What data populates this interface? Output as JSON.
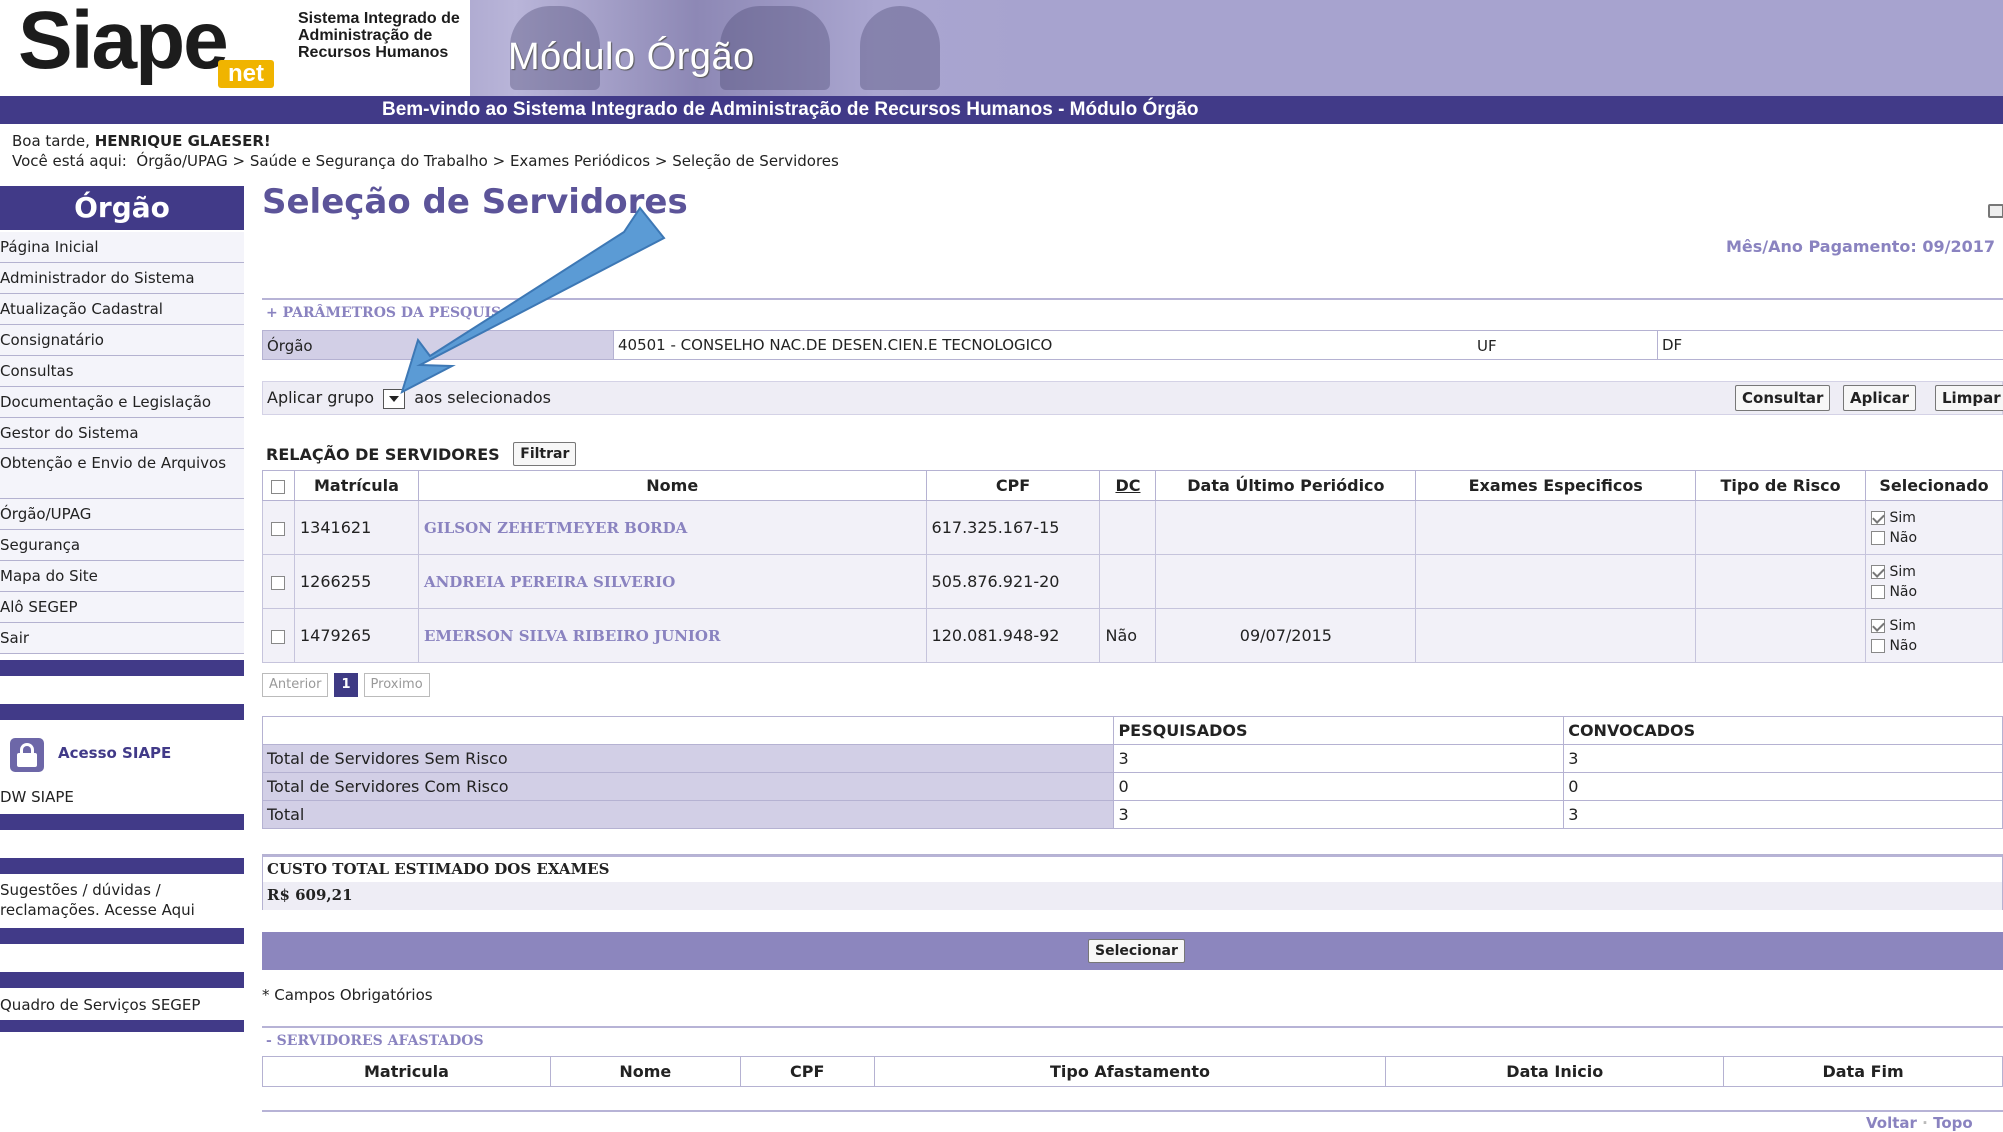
{
  "header": {
    "logo_main": "Siape",
    "logo_net": "net",
    "logo_sub_line1": "Sistema Integrado de",
    "logo_sub_line2": "Administração de",
    "logo_sub_line3": "Recursos Humanos",
    "module": "Módulo Órgão",
    "welcome": "Bem-vindo ao Sistema Integrado de Administração de Recursos Humanos - Módulo Órgão"
  },
  "greeting": {
    "prefix": "Boa tarde, ",
    "user": "HENRIQUE GLAESER!"
  },
  "breadcrumb": {
    "label": "Você está aqui:",
    "items": [
      "Órgão/UPAG",
      "Saúde e Segurança do Trabalho",
      "Exames Periódicos",
      "Seleção de Servidores"
    ],
    "separator": ">"
  },
  "sidebar": {
    "title": "Órgão",
    "items": [
      {
        "label": "Página Inicial"
      },
      {
        "label": "Administrador do Sistema"
      },
      {
        "label": "Atualização Cadastral"
      },
      {
        "label": "Consignatário"
      },
      {
        "label": "Consultas"
      },
      {
        "label": "Documentação e Legislação"
      },
      {
        "label": "Gestor do Sistema"
      },
      {
        "label": "Obtenção e Envio de Arquivos"
      },
      {
        "label": "Órgão/UPAG"
      },
      {
        "label": "Segurança"
      },
      {
        "label": "Mapa do Site"
      },
      {
        "label": "Alô SEGEP"
      },
      {
        "label": "Sair"
      }
    ],
    "acesso": "Acesso SIAPE",
    "dw": "DW SIAPE",
    "sugestoes_line1": "Sugestões / dúvidas /",
    "sugestoes_line2": "reclamações. Acesse Aqui",
    "quadro": "Quadro de Serviços SEGEP"
  },
  "main": {
    "title": "Seleção de Servidores",
    "mes_ano_label": "Mês/Ano Pagamento:",
    "mes_ano_value": "09/2017",
    "params": {
      "header": "+ PARÂMETROS DA PESQUISA",
      "orgao_label": "Órgão",
      "orgao_value": "40501 - CONSELHO NAC.DE DESEN.CIEN.E TECNOLOGICO",
      "uf_label": "UF",
      "uf_value": "DF"
    },
    "group": {
      "prefix": "Aplicar grupo",
      "suffix": "aos selecionados",
      "consultar": "Consultar",
      "aplicar": "Aplicar",
      "limpar": "Limpar"
    },
    "relacao_title": "RELAÇÃO DE SERVIDORES",
    "filtrar": "Filtrar",
    "columns": [
      "Matrícula",
      "Nome",
      "CPF",
      "DC",
      "Data Último Periódico",
      "Exames Especificos",
      "Tipo de Risco",
      "Selecionado"
    ],
    "sim_label": "Sim",
    "nao_label": "Não",
    "rows": [
      {
        "matricula": "1341621",
        "nome": "GILSON ZEHETMEYER BORDA",
        "cpf": "617.325.167-15",
        "dc": "",
        "data": "",
        "exames": "",
        "risco": ""
      },
      {
        "matricula": "1266255",
        "nome": "ANDREIA PEREIRA SILVERIO",
        "cpf": "505.876.921-20",
        "dc": "",
        "data": "",
        "exames": "",
        "risco": ""
      },
      {
        "matricula": "1479265",
        "nome": "EMERSON SILVA RIBEIRO JUNIOR",
        "cpf": "120.081.948-92",
        "dc": "Não",
        "data": "09/07/2015",
        "exames": "",
        "risco": ""
      }
    ],
    "pager": {
      "prev": "Anterior",
      "page": "1",
      "next": "Proximo"
    },
    "totals": {
      "col_pesq": "PESQUISADOS",
      "col_conv": "CONVOCADOS",
      "rows": [
        {
          "label": "Total de Servidores Sem Risco",
          "pesq": "3",
          "conv": "3"
        },
        {
          "label": "Total de Servidores Com Risco",
          "pesq": "0",
          "conv": "0"
        },
        {
          "label": "Total",
          "pesq": "3",
          "conv": "3"
        }
      ]
    },
    "custo_label": "CUSTO TOTAL ESTIMADO DOS EXAMES",
    "custo_value": "R$ 609,21",
    "selecionar": "Selecionar",
    "campos": "* Campos Obrigatórios",
    "afastados": {
      "header": "- SERVIDORES AFASTADOS",
      "columns": [
        "Matricula",
        "Nome",
        "CPF",
        "Tipo Afastamento",
        "Data Inicio",
        "Data Fim"
      ]
    },
    "footer": {
      "voltar": "Voltar",
      "sep": "·",
      "topo": "Topo"
    }
  },
  "colors": {
    "brand_dark": "#413a88",
    "brand_light": "#a7a3cf",
    "link": "#8a83c0",
    "annotation_arrow": "#5b9bd5"
  }
}
